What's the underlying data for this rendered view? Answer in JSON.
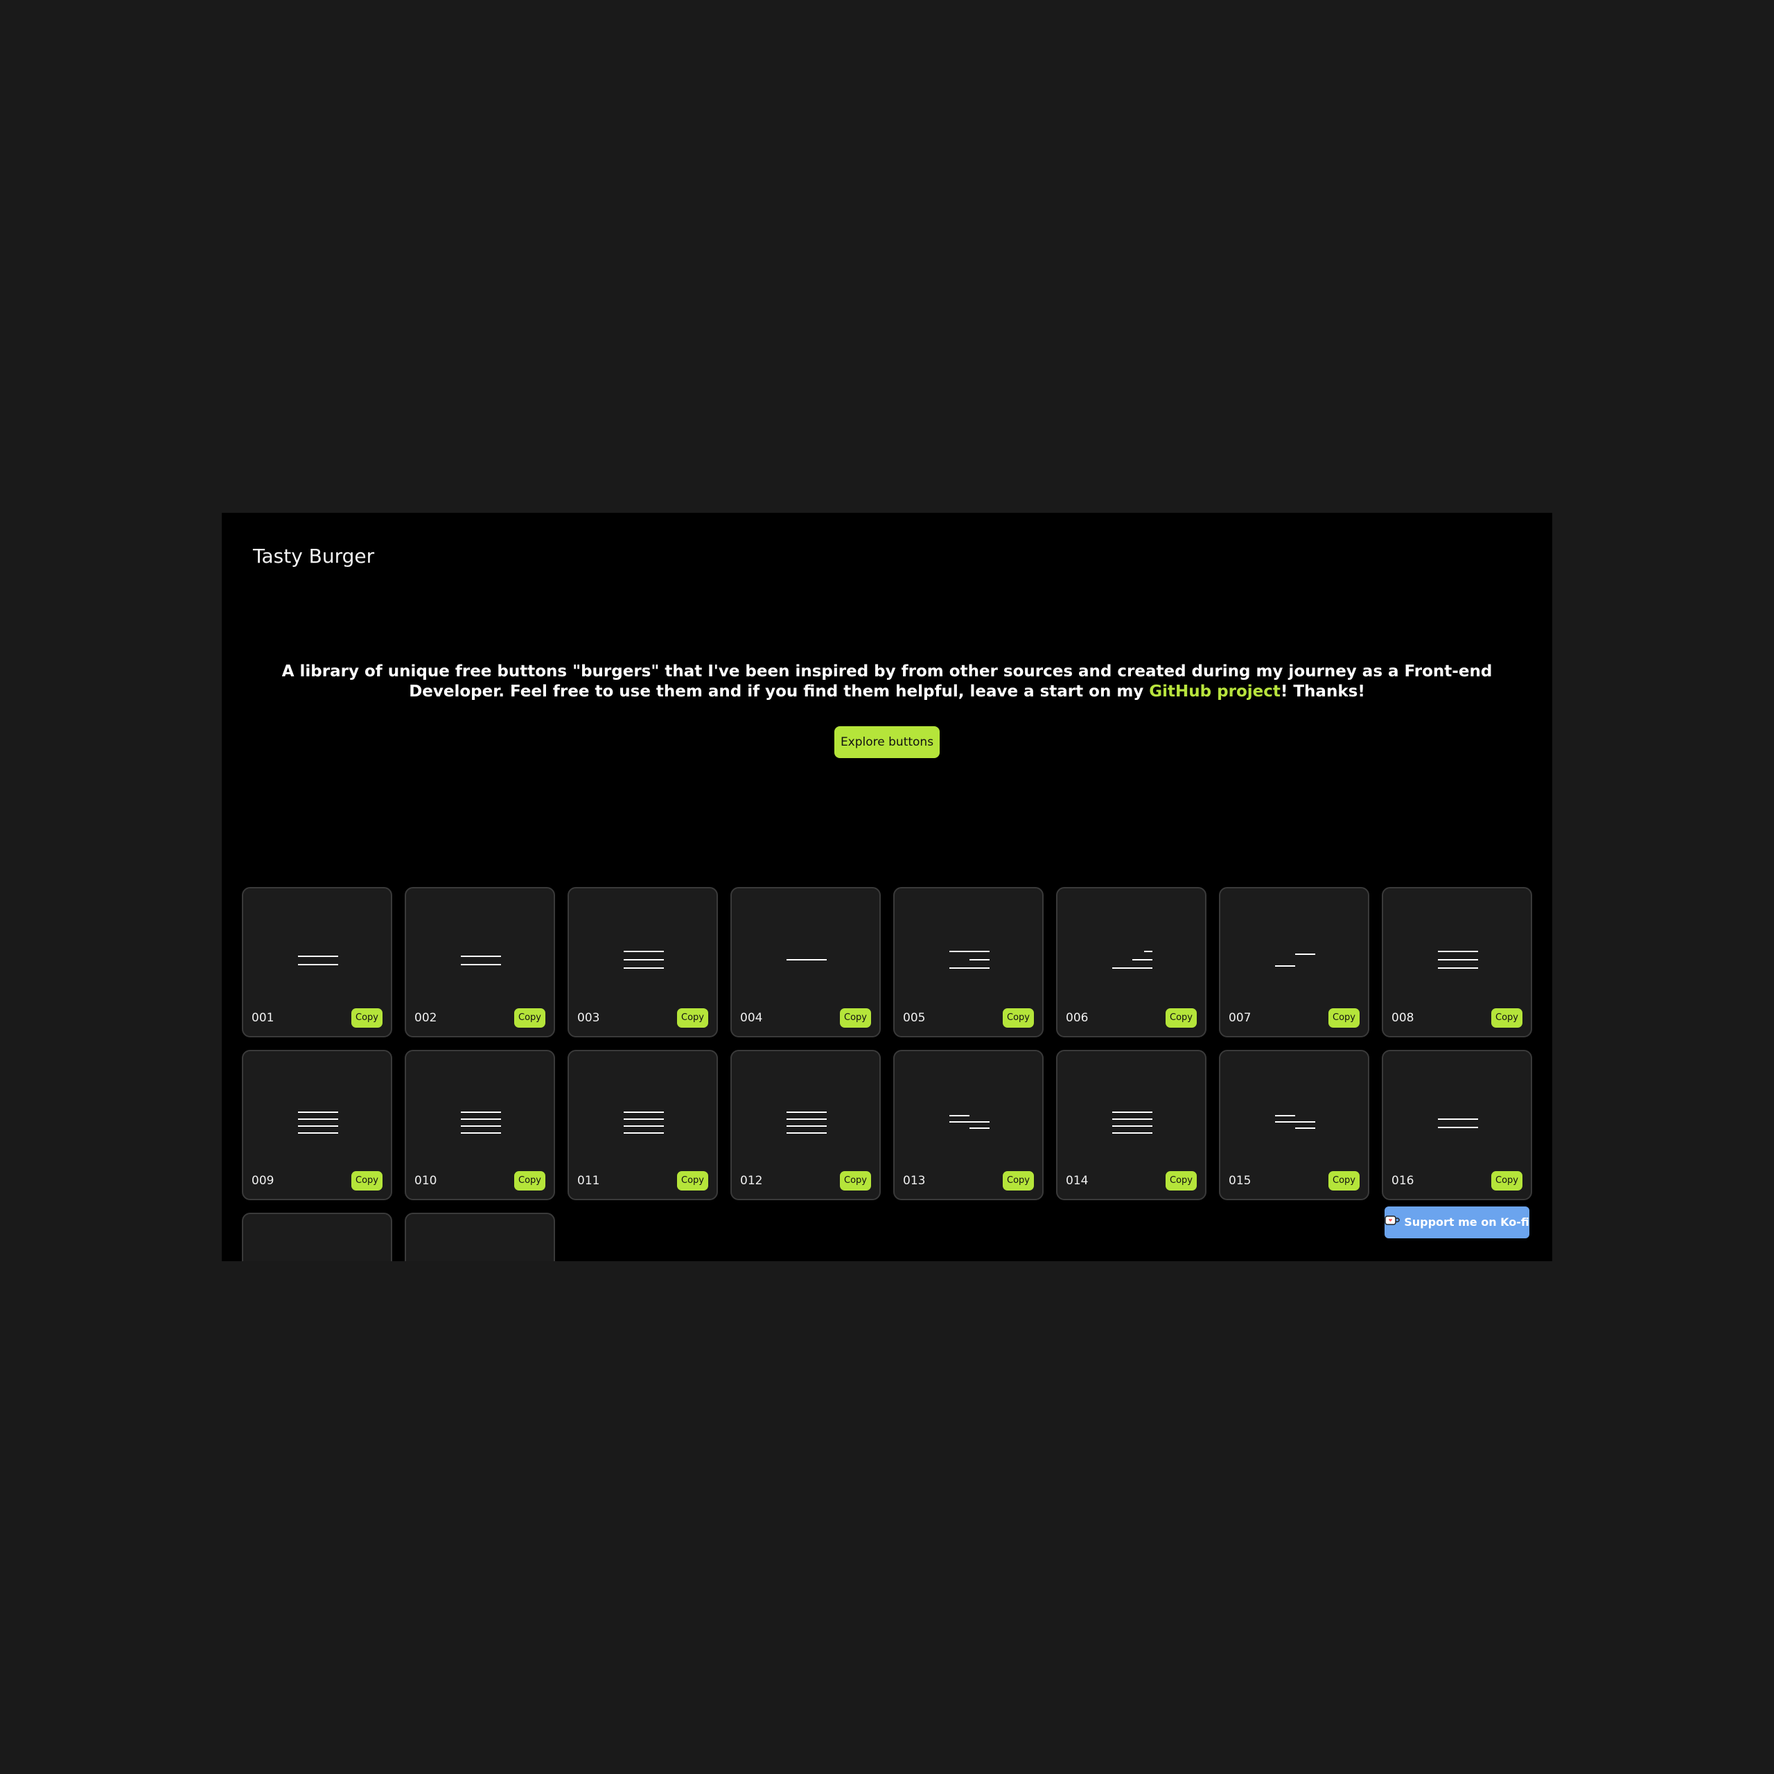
{
  "header": {
    "logo": "Tasty Burger"
  },
  "hero": {
    "text_before": "A library of unique free buttons \"burgers\" that I've been inspired by from other sources and created during my journey as a Front-end Developer. Feel free to use them and if you find them helpful, leave a start on my ",
    "link_text": "GitHub project",
    "text_after": "! Thanks!",
    "cta_label": "Explore buttons"
  },
  "colors": {
    "accent": "#b5e53a",
    "page_background": "#1a1a1a",
    "app_background": "#000000",
    "card_background": "#1c1c1c",
    "kofi_blue": "#6ba4ee"
  },
  "cards": [
    {
      "number": "001",
      "copy_label": "Copy",
      "icon": "two-line-burger-icon"
    },
    {
      "number": "002",
      "copy_label": "Copy",
      "icon": "two-line-burger-icon"
    },
    {
      "number": "003",
      "copy_label": "Copy",
      "icon": "three-line-burger-icon"
    },
    {
      "number": "004",
      "copy_label": "Copy",
      "icon": "single-line-icon"
    },
    {
      "number": "005",
      "copy_label": "Copy",
      "icon": "staggered-burger-icon"
    },
    {
      "number": "006",
      "copy_label": "Copy",
      "icon": "right-stepped-burger-icon"
    },
    {
      "number": "007",
      "copy_label": "Copy",
      "icon": "zigzag-line-icon"
    },
    {
      "number": "008",
      "copy_label": "Copy",
      "icon": "three-line-burger-icon"
    },
    {
      "number": "009",
      "copy_label": "Copy",
      "icon": "four-line-burger-icon"
    },
    {
      "number": "010",
      "copy_label": "Copy",
      "icon": "four-line-burger-icon"
    },
    {
      "number": "011",
      "copy_label": "Copy",
      "icon": "four-line-burger-icon"
    },
    {
      "number": "012",
      "copy_label": "Copy",
      "icon": "four-line-burger-icon"
    },
    {
      "number": "013",
      "copy_label": "Copy",
      "icon": "offset-burger-icon"
    },
    {
      "number": "014",
      "copy_label": "Copy",
      "icon": "four-line-burger-icon"
    },
    {
      "number": "015",
      "copy_label": "Copy",
      "icon": "offset-burger-icon"
    },
    {
      "number": "016",
      "copy_label": "Copy",
      "icon": "two-line-burger-icon"
    },
    {
      "number": "",
      "copy_label": "",
      "icon": ""
    },
    {
      "number": "",
      "copy_label": "",
      "icon": ""
    }
  ],
  "kofi": {
    "label": "Support me on Ko-fi",
    "icon": "coffee-cup-icon"
  }
}
